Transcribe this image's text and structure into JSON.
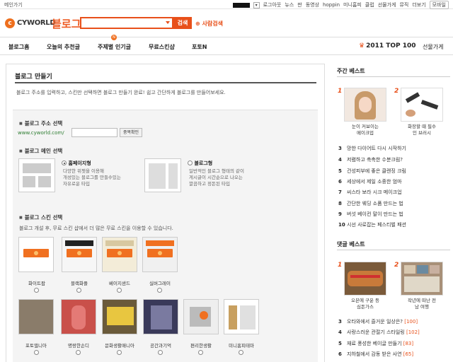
{
  "topbar": {
    "home": "메인가기",
    "links": [
      "로그아웃",
      "뉴스",
      "판",
      "동영상",
      "hoppin",
      "미니홈피",
      "클럽",
      "선물가게",
      "뮤직",
      "더보기"
    ],
    "mobile": "모바일"
  },
  "header": {
    "logo_text": "CYWORLD",
    "service": "블로그",
    "search_button": "검색",
    "people_search": "사람검색"
  },
  "nav": {
    "items": [
      "블로그홈",
      "오늘의 추천글",
      "주제별 인기글",
      "무료스킨샵",
      "포토N"
    ],
    "top100": "2011 TOP 100",
    "gift": "선물가게"
  },
  "main": {
    "title": "블로그 만들기",
    "desc": "블로그 주소를 입력하고, 스킨만 선택하면 블로그 만들기 완료! 쉽고 간단하게 블로그를 만들어보세요.",
    "address": {
      "label": "블로그 주소 선택",
      "url": "www.cyworld.com/",
      "check_button": "중복확인"
    },
    "main_select": {
      "label": "블로그 메인 선택",
      "options": [
        {
          "title": "홈페이지형",
          "desc1": "다양한 위젯을 이용해",
          "desc2": "개성있는 블로그를 만들수있는",
          "desc3": "자유로운 타입"
        },
        {
          "title": "블로그형",
          "desc1": "일반적인 블로그 형태의 같이",
          "desc2": "게시글이 시간순으로 나오는",
          "desc3": "깔끔하고 정돈된 타입"
        }
      ]
    },
    "skin": {
      "label": "블로그 스킨 선택",
      "desc": "블로그 개설 후, 무료 스킨 샵에서 더 많은 무료 스킨을 이용할 수 있습니다.",
      "row1": [
        "화이트팝",
        "블랙화플",
        "베이지샌드",
        "실버그레이"
      ],
      "row2": [
        "포토앨니아",
        "명랑한손디",
        "문화생활매니아",
        "공간과기억",
        "편리한생활",
        "미니홈피테마"
      ]
    }
  },
  "side": {
    "weekly_title": "주간 베스트",
    "weekly_top": [
      {
        "rank": "1",
        "cap1": "눈이 커보이는",
        "cap2": "메이크업"
      },
      {
        "rank": "2",
        "cap1": "화장할 때 필수",
        "cap2": "인 브러시"
      }
    ],
    "weekly_list": [
      {
        "rank": "3",
        "text": "망한 다이어트 다시 시작하기"
      },
      {
        "rank": "4",
        "text": "저렴하고 촉촉한 수분크림?"
      },
      {
        "rank": "5",
        "text": "건성피부에 좋은 클렌징 크림"
      },
      {
        "rank": "6",
        "text": "세상에서 제일 소중한 엄마"
      },
      {
        "rank": "7",
        "text": "씨스타 보라 시크 메이크업"
      },
      {
        "rank": "8",
        "text": "간단한 웨딩 소품 만드는 법"
      },
      {
        "rank": "9",
        "text": "버섯 베이컨 말이 만드는 법"
      },
      {
        "rank": "10",
        "text": "시선 사로잡는 페스티벌 패션"
      }
    ],
    "reply_title": "댓글 베스트",
    "reply_top": [
      {
        "rank": "1",
        "cap1": "오븐에 구운 등",
        "cap2": "심돈가스"
      },
      {
        "rank": "2",
        "cap1": "작년에 떠난 전",
        "cap2": "남 여행"
      }
    ],
    "reply_list": [
      {
        "rank": "3",
        "text": "오타와에서 즐거운 일상은?",
        "count": "[100]"
      },
      {
        "rank": "4",
        "text": "사랑스러운 관절기 스타일링",
        "count": "[102]"
      },
      {
        "rank": "5",
        "text": "재료 풍성한 베이글 만들기",
        "count": "[83]"
      },
      {
        "rank": "6",
        "text": "지하철에서 감동 받은 사연",
        "count": "[65]"
      }
    ]
  },
  "colors": {
    "accent": "#e8501a",
    "url_green": "#2e7d32"
  }
}
